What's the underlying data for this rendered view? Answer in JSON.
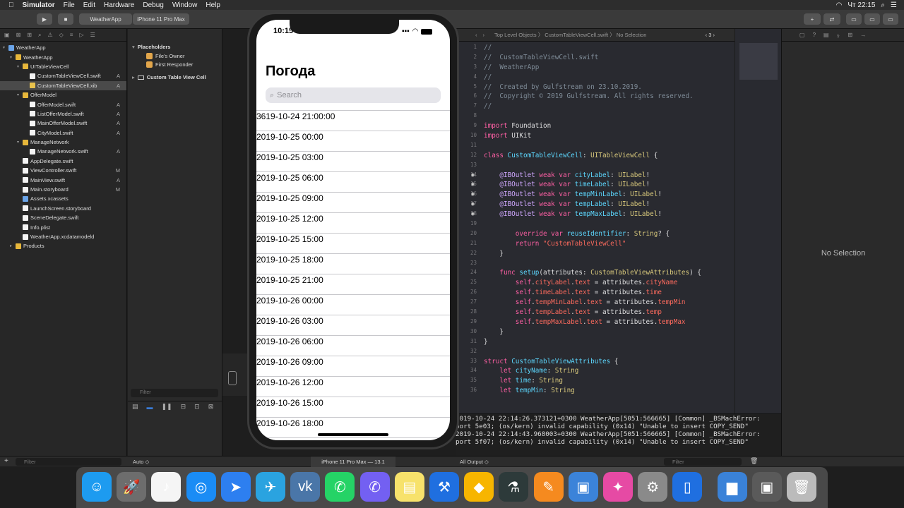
{
  "menubar": {
    "app": "Simulator",
    "items": [
      "File",
      "Edit",
      "Hardware",
      "Debug",
      "Window",
      "Help"
    ],
    "clock": "Чт 22:15"
  },
  "toolbar": {
    "scheme": "WeatherApp",
    "device": "iPhone 11 Pro Max"
  },
  "navigator": {
    "filter_placeholder": "Filter",
    "items": [
      {
        "label": "WeatherApp",
        "indent": 0,
        "kind": "ws",
        "status": ""
      },
      {
        "label": "WeatherApp",
        "indent": 1,
        "kind": "folder",
        "status": ""
      },
      {
        "label": "UITableViewCell",
        "indent": 2,
        "kind": "folder",
        "status": ""
      },
      {
        "label": "CustomTableViewCell.swift",
        "indent": 3,
        "kind": "file",
        "status": "A"
      },
      {
        "label": "CustomTableViewCell.xib",
        "indent": 3,
        "kind": "xib",
        "status": "A",
        "selected": true
      },
      {
        "label": "OfferModel",
        "indent": 2,
        "kind": "folder",
        "status": ""
      },
      {
        "label": "OfferModel.swift",
        "indent": 3,
        "kind": "file",
        "status": "A"
      },
      {
        "label": "ListOfferModel.swift",
        "indent": 3,
        "kind": "file",
        "status": "A"
      },
      {
        "label": "MainOfferModel.swift",
        "indent": 3,
        "kind": "file",
        "status": "A"
      },
      {
        "label": "CityModel.swift",
        "indent": 3,
        "kind": "file",
        "status": "A"
      },
      {
        "label": "ManageNetwork",
        "indent": 2,
        "kind": "folder",
        "status": ""
      },
      {
        "label": "ManageNetwork.swift",
        "indent": 3,
        "kind": "file",
        "status": "A"
      },
      {
        "label": "AppDelegate.swift",
        "indent": 2,
        "kind": "file",
        "status": ""
      },
      {
        "label": "ViewController.swift",
        "indent": 2,
        "kind": "file",
        "status": "M"
      },
      {
        "label": "MainView.swift",
        "indent": 2,
        "kind": "file",
        "status": "A"
      },
      {
        "label": "Main.storyboard",
        "indent": 2,
        "kind": "file",
        "status": "M"
      },
      {
        "label": "Assets.xcassets",
        "indent": 2,
        "kind": "ws",
        "status": ""
      },
      {
        "label": "LaunchScreen.storyboard",
        "indent": 2,
        "kind": "file",
        "status": ""
      },
      {
        "label": "SceneDelegate.swift",
        "indent": 2,
        "kind": "file",
        "status": ""
      },
      {
        "label": "Info.plist",
        "indent": 2,
        "kind": "file",
        "status": ""
      },
      {
        "label": "WeatherApp.xcdatamodeld",
        "indent": 2,
        "kind": "file",
        "status": ""
      },
      {
        "label": "Products",
        "indent": 1,
        "kind": "folder",
        "status": ""
      }
    ]
  },
  "ib": {
    "placeholders": "Placeholders",
    "files_owner": "File's Owner",
    "first_responder": "First Responder",
    "cell": "Custom Table View Cell",
    "filter_placeholder": "Filter"
  },
  "editor": {
    "breadcrumb": "Top Level Objects  〉  CustomTableViewCell.swift  〉  No Selection",
    "counter": "3"
  },
  "code": [
    {
      "n": "1",
      "h": "<span class='cm'>//</span>"
    },
    {
      "n": "2",
      "h": "<span class='cm'>//  CustomTableViewCell.swift</span>"
    },
    {
      "n": "3",
      "h": "<span class='cm'>//  WeatherApp</span>"
    },
    {
      "n": "4",
      "h": "<span class='cm'>//</span>"
    },
    {
      "n": "5",
      "h": "<span class='cm'>//  Created by Gulfstream on 23.10.2019.</span>"
    },
    {
      "n": "6",
      "h": "<span class='cm'>//  Copyright © 2019 Gulfstream. All rights reserved.</span>"
    },
    {
      "n": "7",
      "h": "<span class='cm'>//</span>"
    },
    {
      "n": "8",
      "h": ""
    },
    {
      "n": "9",
      "h": "<span class='kw'>import</span> Foundation"
    },
    {
      "n": "10",
      "h": "<span class='kw'>import</span> UIKit"
    },
    {
      "n": "11",
      "h": ""
    },
    {
      "n": "12",
      "h": "<span class='kw'>class</span> <span class='ty'>CustomTableViewCell</span>: <span class='yl'>UITableViewCell</span> {"
    },
    {
      "n": "13",
      "h": ""
    },
    {
      "n": "14",
      "h": "    <span class='tx'>@IBOutlet</span> <span class='kw'>weak var</span> <span class='ty'>cityLabel</span>: <span class='yl'>UILabel</span>!"
    },
    {
      "n": "15",
      "h": "    <span class='tx'>@IBOutlet</span> <span class='kw'>weak var</span> <span class='ty'>timeLabel</span>: <span class='yl'>UILabel</span>!"
    },
    {
      "n": "16",
      "h": "    <span class='tx'>@IBOutlet</span> <span class='kw'>weak var</span> <span class='ty'>tempMinLabel</span>: <span class='yl'>UILabel</span>!"
    },
    {
      "n": "17",
      "h": "    <span class='tx'>@IBOutlet</span> <span class='kw'>weak var</span> <span class='ty'>tempLabel</span>: <span class='yl'>UILabel</span>!"
    },
    {
      "n": "18",
      "h": "    <span class='tx'>@IBOutlet</span> <span class='kw'>weak var</span> <span class='ty'>tempMaxLabel</span>: <span class='yl'>UILabel</span>!"
    },
    {
      "n": "19",
      "h": ""
    },
    {
      "n": "20",
      "h": "        <span class='kw'>override var</span> <span class='ty'>reuseIdentifier</span>: <span class='yl'>String</span>? {"
    },
    {
      "n": "21",
      "h": "        <span class='kw'>return</span> <span class='st2'>\"CustomTableViewCell\"</span>"
    },
    {
      "n": "22",
      "h": "    }"
    },
    {
      "n": "23",
      "h": ""
    },
    {
      "n": "24",
      "h": "    <span class='kw'>func</span> <span class='ty'>setup</span>(attributes: <span class='yl'>CustomTableViewAttributes</span>) {"
    },
    {
      "n": "25",
      "h": "        <span class='kw'>self</span>.<span class='st2'>cityLabel</span>.<span class='st2'>text</span> = attributes.<span class='st2'>cityName</span>"
    },
    {
      "n": "26",
      "h": "        <span class='kw'>self</span>.<span class='st2'>timeLabel</span>.<span class='st2'>text</span> = attributes.<span class='st2'>time</span>"
    },
    {
      "n": "27",
      "h": "        <span class='kw'>self</span>.<span class='st2'>tempMinLabel</span>.<span class='st2'>text</span> = attributes.<span class='st2'>tempMin</span>"
    },
    {
      "n": "28",
      "h": "        <span class='kw'>self</span>.<span class='st2'>tempLabel</span>.<span class='st2'>text</span> = attributes.<span class='st2'>temp</span>"
    },
    {
      "n": "29",
      "h": "        <span class='kw'>self</span>.<span class='st2'>tempMaxLabel</span>.<span class='st2'>text</span> = attributes.<span class='st2'>tempMax</span>"
    },
    {
      "n": "30",
      "h": "    }"
    },
    {
      "n": "31",
      "h": "}"
    },
    {
      "n": "32",
      "h": ""
    },
    {
      "n": "33",
      "h": "<span class='kw'>struct</span> <span class='ty'>CustomTableViewAttributes</span> {"
    },
    {
      "n": "34",
      "h": "    <span class='kw'>let</span> <span class='ty'>cityName</span>: <span class='yl'>String</span>"
    },
    {
      "n": "35",
      "h": "    <span class='kw'>let</span> <span class='ty'>time</span>: <span class='yl'>String</span>"
    },
    {
      "n": "36",
      "h": "    <span class='kw'>let</span> <span class='ty'>tempMin</span>: <span class='yl'>String</span>"
    }
  ],
  "inspector": {
    "empty": "No Selection"
  },
  "console": {
    "lines": [
      "2019-10-24 22:14:26.373121+0300 WeatherApp[5051:566665] [Common] _BSMachError:",
      "    port 5e03; (os/kern) invalid capability (0x14) \"Unable to insert COPY_SEND\"",
      "2019-10-24 22:14:43.968003+0300 WeatherApp[5051:566665] [Common] _BSMachError:",
      "    port 5f07; (os/kern) invalid capability (0x14) \"Unable to insert COPY_SEND\""
    ]
  },
  "bottombar": {
    "filter_placeholder": "Filter",
    "auto": "Auto ◇",
    "device_label": "iPhone 11 Pro Max — 13.1",
    "all_output": "All Output ◇",
    "filter2": "Filter"
  },
  "phone": {
    "time": "10:15",
    "title": "Погода",
    "search_placeholder": "Search",
    "rows": [
      "3619-10-24 21:00:00",
      "2019-10-25 00:00",
      "2019-10-25 03:00",
      "2019-10-25 06:00",
      "2019-10-25 09:00",
      "2019-10-25 12:00",
      "2019-10-25 15:00",
      "2019-10-25 18:00",
      "2019-10-25 21:00",
      "2019-10-26 00:00",
      "2019-10-26 03:00",
      "2019-10-26 06:00",
      "2019-10-26 09:00",
      "2019-10-26 12:00",
      "2019-10-26 15:00",
      "2019-10-26 18:00"
    ]
  },
  "dock": {
    "apps": [
      "finder-icon",
      "launchpad-icon",
      "music-icon",
      "safari-icon",
      "send-icon",
      "telegram-icon",
      "vk-icon",
      "whatsapp-icon",
      "viber-icon",
      "notes-icon",
      "xcode-icon",
      "sketch-icon",
      "instruments-icon",
      "pages-icon",
      "keynote-icon",
      "pixelmator-icon",
      "preferences-icon",
      "simulator-icon",
      "folder-icon",
      "screenshot-icon",
      "trash-icon"
    ]
  }
}
